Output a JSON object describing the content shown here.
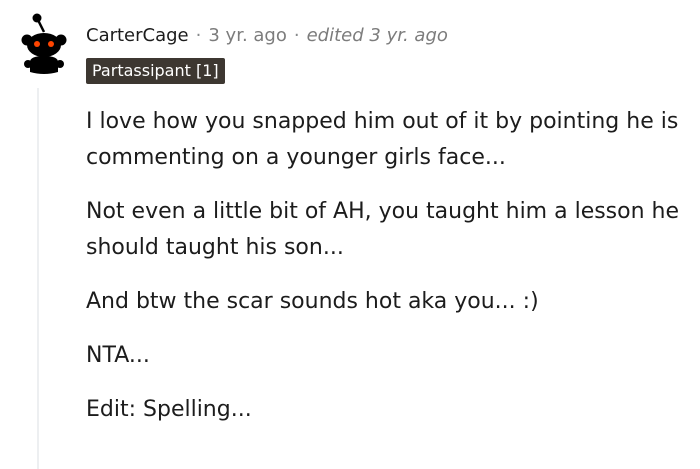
{
  "comment": {
    "author": "CarterCage",
    "separator": "·",
    "timestamp": "3 yr. ago",
    "edited": "edited 3 yr. ago",
    "flair": "Partassipant [1]",
    "avatar_icon": "snoo-avatar-icon",
    "paragraphs": [
      "I love how you snapped him out of it by pointing he is commenting on a younger girls face...",
      "Not even a little bit of AH, you taught him a lesson he should taught his son...",
      "And btw the scar sounds hot aka you... :)",
      "NTA...",
      "Edit: Spelling..."
    ]
  },
  "colors": {
    "flair_background": "#3d3731",
    "flair_text": "#ffffff",
    "meta_text": "#7c7c7c",
    "thread_line": "#edeff1",
    "avatar_eyes": "#ff4500"
  }
}
